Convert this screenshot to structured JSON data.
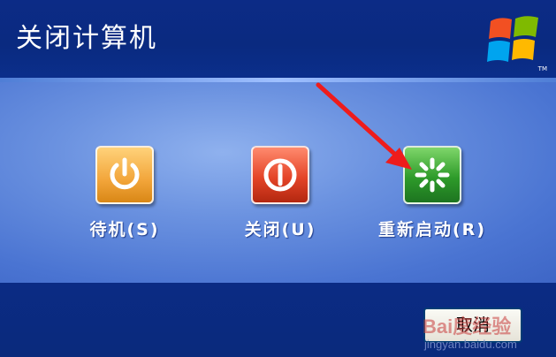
{
  "dialog": {
    "title": "关闭计算机",
    "logo_tm": "TM"
  },
  "options": [
    {
      "label": "待机",
      "key": "(S)",
      "color": "#f2a53a",
      "icon": "power-icon"
    },
    {
      "label": "关闭",
      "key": "(U)",
      "color": "#e44528",
      "icon": "shutdown-icon"
    },
    {
      "label": "重新启动",
      "key": "(R)",
      "color": "#2e9b2a",
      "icon": "restart-icon"
    }
  ],
  "footer": {
    "cancel_label": "取消",
    "watermark": "Bai度经验",
    "watermark_url": "jingyan.baidu.com"
  },
  "colors": {
    "header": "#0a2a80",
    "body": "#6b92e0",
    "arrow": "#ee1c1c"
  }
}
